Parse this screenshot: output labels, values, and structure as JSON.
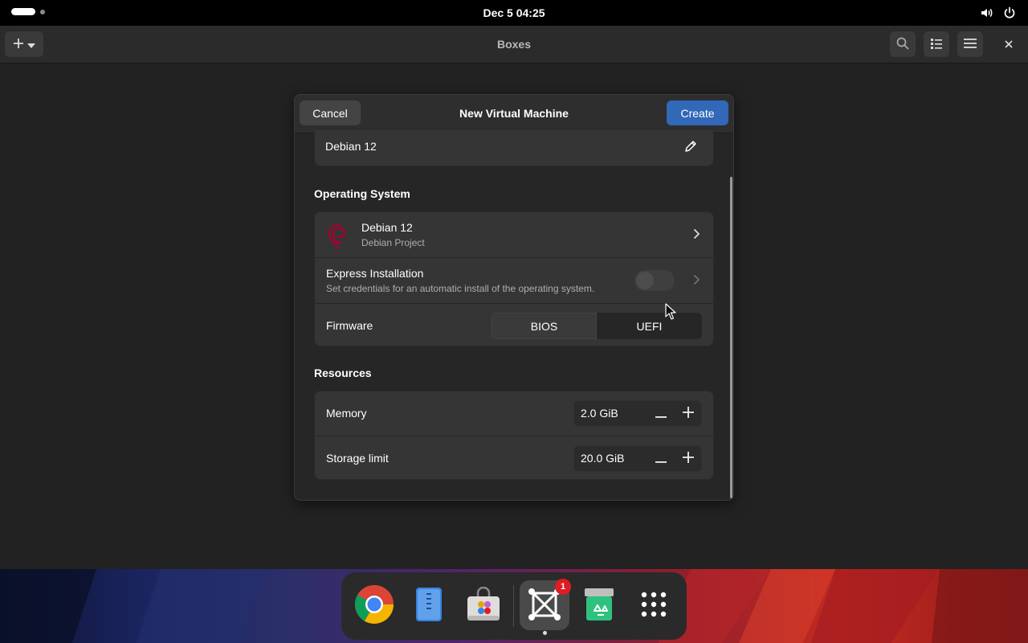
{
  "topbar": {
    "clock": "Dec 5  04:25"
  },
  "app": {
    "title": "Boxes"
  },
  "dialog": {
    "title": "New Virtual Machine",
    "cancel_label": "Cancel",
    "create_label": "Create",
    "name_value": "Debian 12",
    "os_section": {
      "heading": "Operating System",
      "os_name": "Debian 12",
      "os_vendor": "Debian Project",
      "express_title": "Express Installation",
      "express_subtitle": "Set credentials for an automatic install of the operating system.",
      "express_enabled": false,
      "firmware_label": "Firmware",
      "firmware_options": [
        "BIOS",
        "UEFI"
      ],
      "firmware_selected": "UEFI"
    },
    "resources": {
      "heading": "Resources",
      "memory_label": "Memory",
      "memory_value": "2.0 GiB",
      "storage_label": "Storage limit",
      "storage_value": "20.0 GiB"
    }
  },
  "dock": {
    "items": [
      "google-chrome",
      "text-editor",
      "software-store",
      "boxes",
      "trash",
      "app-grid"
    ],
    "boxes_badge": "1"
  },
  "colors": {
    "accent": "#3168b8",
    "badge": "#e01b24",
    "debian": "#a80030"
  }
}
